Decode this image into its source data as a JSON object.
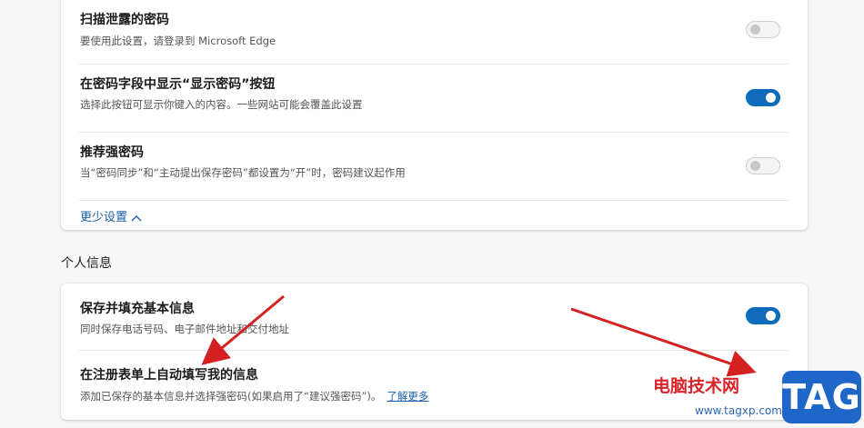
{
  "password_settings": {
    "rows": [
      {
        "title": "扫描泄露的密码",
        "desc": "要使用此设置，请登录到 Microsoft Edge",
        "toggle_on": false
      },
      {
        "title": "在密码字段中显示“显示密码”按钮",
        "desc": "选择此按钮可显示你键入的内容。一些网站可能会覆盖此设置",
        "toggle_on": true
      },
      {
        "title": "推荐强密码",
        "desc": "当“密码同步”和“主动提出保存密码”都设置为“开”时，密码建议起作用",
        "toggle_on": false
      }
    ],
    "less_settings_label": "更少设置"
  },
  "personal_info": {
    "section_title": "个人信息",
    "rows": [
      {
        "title": "保存并填充基本信息",
        "desc": "同时保存电话号码、电子邮件地址和交付地址",
        "toggle_on": true
      },
      {
        "title": "在注册表单上自动填写我的信息",
        "desc": "添加已保存的基本信息并选择强密码(如果启用了“建议强密码”)。",
        "learn_more": "了解更多"
      }
    ]
  },
  "watermark": {
    "text": "电脑技术网",
    "tag": "TAG",
    "url": "www.tagxp.com"
  },
  "colors": {
    "accent": "#0f6cbd",
    "link": "#1b5fa8",
    "arrow": "#d42020"
  }
}
